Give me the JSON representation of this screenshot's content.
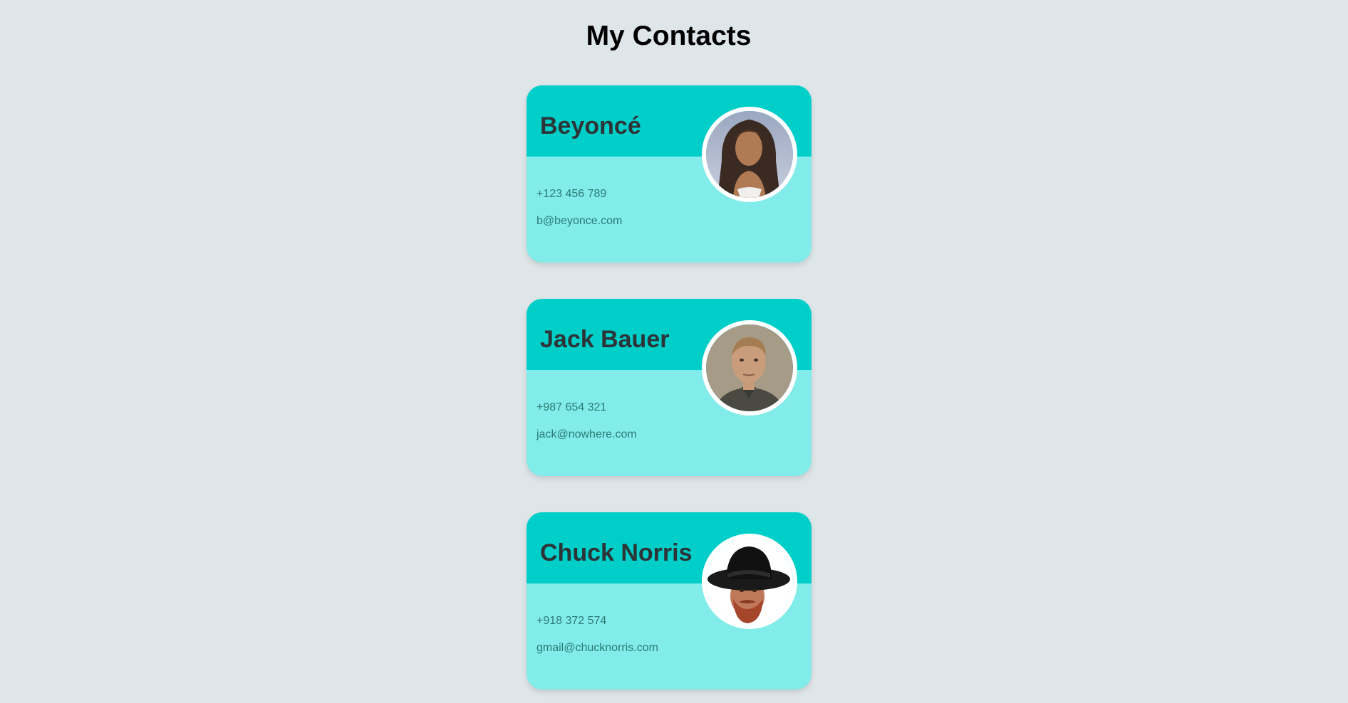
{
  "page": {
    "title": "My Contacts"
  },
  "contacts": [
    {
      "name": "Beyoncé",
      "phone": "+123 456 789",
      "email": "b@beyonce.com",
      "avatar": "beyonce-photo"
    },
    {
      "name": "Jack Bauer",
      "phone": "+987 654 321",
      "email": "jack@nowhere.com",
      "avatar": "jack-bauer-photo"
    },
    {
      "name": "Chuck Norris",
      "phone": "+918 372 574",
      "email": "gmail@chucknorris.com",
      "avatar": "chuck-norris-photo"
    }
  ],
  "colors": {
    "background": "#dfe6e9",
    "card_header": "#00cec9",
    "card_body": "#81ece9",
    "name_text": "#2d3436",
    "detail_text": "#2d7a77"
  }
}
